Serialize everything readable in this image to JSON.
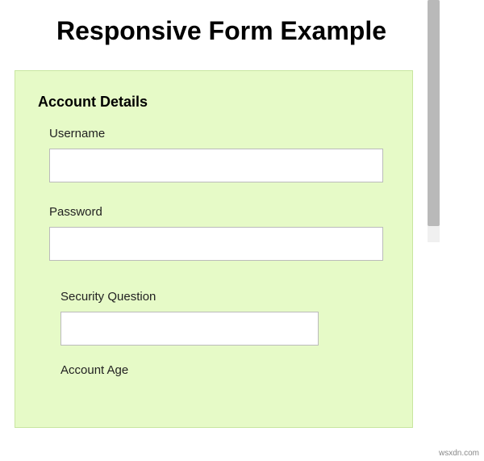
{
  "page": {
    "title": "Responsive Form Example"
  },
  "form": {
    "section_title": "Account Details",
    "username": {
      "label": "Username",
      "value": ""
    },
    "password": {
      "label": "Password",
      "value": ""
    },
    "security_question": {
      "label": "Security Question",
      "value": ""
    },
    "account_age": {
      "label": "Account Age"
    }
  },
  "watermark": "wsxdn.com"
}
